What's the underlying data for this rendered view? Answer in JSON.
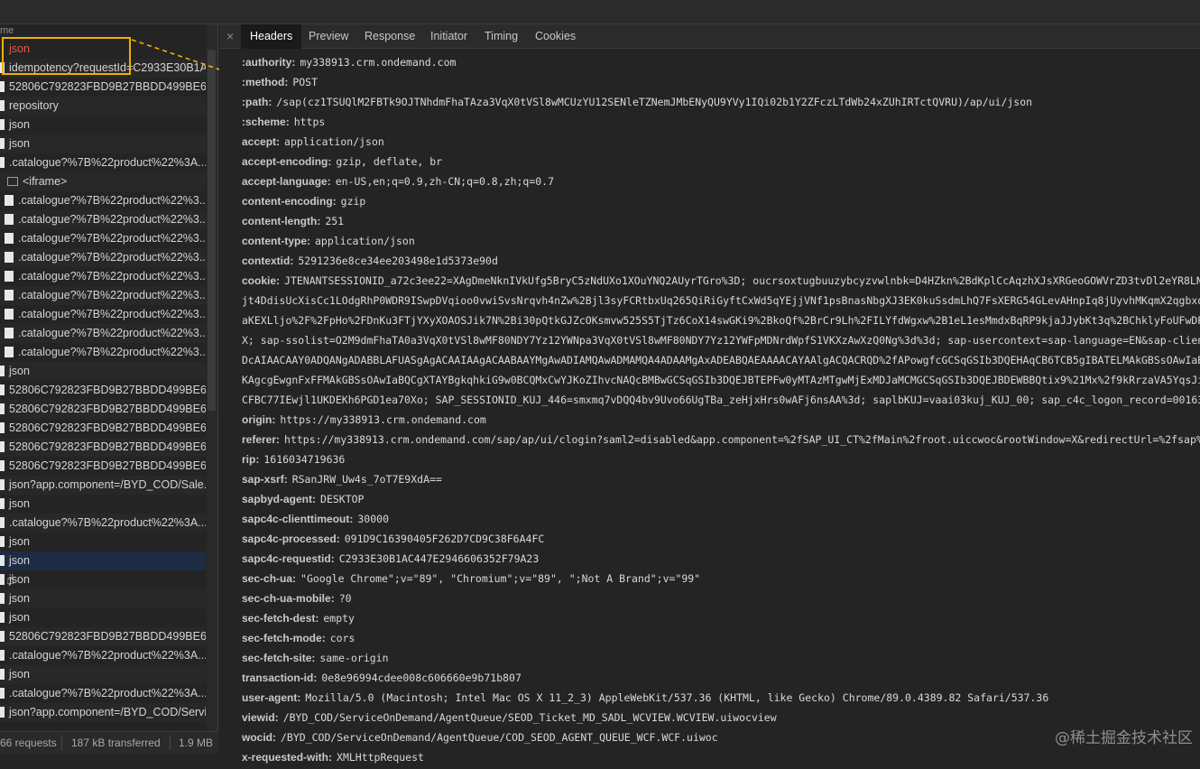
{
  "left_panel": {
    "header_label": "me",
    "items": [
      {
        "label": "json",
        "type": "red"
      },
      {
        "label": "idempotency?requestId=C2933E30B1A...",
        "type": "file"
      },
      {
        "label": "52806C792823FBD9B27BBDD499BE6...",
        "type": "file"
      },
      {
        "label": "repository",
        "type": "file"
      },
      {
        "label": "json",
        "type": "file"
      },
      {
        "label": "json",
        "type": "file"
      },
      {
        "label": ".catalogue?%7B%22product%22%3A...",
        "type": "file"
      },
      {
        "label": "<iframe>",
        "type": "frame"
      },
      {
        "label": ".catalogue?%7B%22product%22%3...",
        "type": "indent"
      },
      {
        "label": ".catalogue?%7B%22product%22%3...",
        "type": "indent"
      },
      {
        "label": ".catalogue?%7B%22product%22%3...",
        "type": "indent"
      },
      {
        "label": ".catalogue?%7B%22product%22%3...",
        "type": "indent"
      },
      {
        "label": ".catalogue?%7B%22product%22%3...",
        "type": "indent"
      },
      {
        "label": ".catalogue?%7B%22product%22%3...",
        "type": "indent"
      },
      {
        "label": ".catalogue?%7B%22product%22%3...",
        "type": "indent"
      },
      {
        "label": ".catalogue?%7B%22product%22%3...",
        "type": "indent"
      },
      {
        "label": ".catalogue?%7B%22product%22%3...",
        "type": "indent"
      },
      {
        "label": "json",
        "type": "file"
      },
      {
        "label": "52806C792823FBD9B27BBDD499BE6...",
        "type": "file"
      },
      {
        "label": "52806C792823FBD9B27BBDD499BE6...",
        "type": "file"
      },
      {
        "label": "52806C792823FBD9B27BBDD499BE6...",
        "type": "file"
      },
      {
        "label": "52806C792823FBD9B27BBDD499BE6...",
        "type": "file"
      },
      {
        "label": "52806C792823FBD9B27BBDD499BE6...",
        "type": "file"
      },
      {
        "label": "json?app.component=/BYD_COD/Sale...",
        "type": "file"
      },
      {
        "label": "json",
        "type": "file"
      },
      {
        "label": ".catalogue?%7B%22product%22%3A...",
        "type": "file"
      },
      {
        "label": "json",
        "type": "file"
      },
      {
        "label": "json",
        "type": "selected"
      },
      {
        "label": "json",
        "type": "file"
      },
      {
        "label": "json",
        "type": "file"
      },
      {
        "label": "json",
        "type": "file"
      },
      {
        "label": "52806C792823FBD9B27BBDD499BE6...",
        "type": "file"
      },
      {
        "label": ".catalogue?%7B%22product%22%3A...",
        "type": "file"
      },
      {
        "label": "json",
        "type": "file"
      },
      {
        "label": ".catalogue?%7B%22product%22%3A...",
        "type": "file"
      },
      {
        "label": "json?app.component=/BYD_COD/Servi...",
        "type": "file"
      }
    ],
    "status": {
      "requests": "66 requests",
      "transferred": "187 kB transferred",
      "resources": "1.9 MB"
    }
  },
  "tabs": [
    {
      "label": "Headers",
      "active": true
    },
    {
      "label": "Preview",
      "active": false
    },
    {
      "label": "Response",
      "active": false
    },
    {
      "label": "Initiator",
      "active": false
    },
    {
      "label": "Timing",
      "active": false
    },
    {
      "label": "Cookies",
      "active": false
    }
  ],
  "headers": [
    {
      "k": ":authority:",
      "v": "my338913.crm.ondemand.com"
    },
    {
      "k": ":method:",
      "v": "POST"
    },
    {
      "k": ":path:",
      "v": "/sap(cz1TSUQlM2FBTk9OJTNhdmFhaTAza3VqX0tVSl8wMCUzYU12SENleTZNemJMbENyQU9YVy1IQi02b1Y2ZFczLTdWb24xZUhIRTctQVRU)/ap/ui/json"
    },
    {
      "k": ":scheme:",
      "v": "https"
    },
    {
      "k": "accept:",
      "v": "application/json"
    },
    {
      "k": "accept-encoding:",
      "v": "gzip, deflate, br"
    },
    {
      "k": "accept-language:",
      "v": "en-US,en;q=0.9,zh-CN;q=0.8,zh;q=0.7"
    },
    {
      "k": "content-encoding:",
      "v": "gzip"
    },
    {
      "k": "content-length:",
      "v": "251"
    },
    {
      "k": "content-type:",
      "v": "application/json"
    },
    {
      "k": "contextid:",
      "v": "5291236e8ce34ee203498e1d5373e90d"
    },
    {
      "k": "cookie:",
      "v": "JTENANTSESSIONID_a72c3ee22=XAgDmeNknIVkUfg5BryC5zNdUXo1XOuYNQ2AUyrTGro%3D; oucrsoxtugbuuzybcyzvwlnbk=D4HZkn%2BdKplCcAqzhXJsXRGeoGOWVrZD3tvDl2eYR8LN0tyPqM"
    },
    {
      "k": "",
      "v": "jt4DdisUcXisCc1LOdgRhP0WDR9ISwpDVqioo0vwiSvsNrqvh4nZw%2Bjl3syFCRtbxUq265QiRiGyftCxWd5qYEjjVNf1psBnasNbgXJ3EK0kuSsdmLhQ7FsXERG54GLevAHnpIq8jUyvhMKqmX2qgbxq7b21W"
    },
    {
      "k": "",
      "v": "aKEXLljo%2F%2FpHo%2FDnKu3FTjYXyXOAOSJik7N%2Bi30pQtkGJZcOKsmvw525S5TjTz6CoX14swGKi9%2BkoQf%2BrCr9Lh%2FILYfdWgxw%2B1eL1esMmdxBqRP9kjaJJybKt3q%2BChklyFoUFwDPKAg69W"
    },
    {
      "k": "",
      "v": "X; sap-ssolist=O2M9dmFhaTA0a3VqX0tVSl8wMF80NDY7Yz12YWNpa3VqX0tVSl8wMF80NDY7Yz12YWFpMDNrdWpfS1VKXzAwXzQ0Ng%3d%3d; sap-usercontext=sap-language=EN&sap-client=446;"
    },
    {
      "k": "",
      "v": "DcAIAACAAY0ADQANgADABBLAFUASgAgACAAIAAgACAABAAYMgAwADIAMQAwADMAMQA4ADAAMgAxADEABQAEAAAACAYAAlgACQACRQD%2fAPowgfcGCSqGSIb3DQEHAqCB6TCB5gIBATELMAkGBSsOAwIaBQAwCwYJ"
    },
    {
      "k": "",
      "v": "KAgcgEwgnFxFFMAkGBSsOAwIaBQCgXTAYBgkqhkiG9w0BCQMxCwYJKoZIhvcNAQcBMBwGCSqGSIb3DQEJBTEPFw0yMTAzMTgwMjExMDJaMCMGCSqGSIb3DQEJBDEWBBQtix9%21Mx%2f9kRrzaVA5YqsJiJ8qtjA"
    },
    {
      "k": "",
      "v": "CFBC77IEwjl1UKDEKh6PGD1ea70Xo; SAP_SESSIONID_KUJ_446=smxmq7vDQQ4bv9Uvo66UgTBa_zeHjxHrs0wAFj6nsAA%3d; saplbKUJ=vaai03kuj_KUJ_00; sap_c4c_logon_record=00163EA7B0A"
    },
    {
      "k": "origin:",
      "v": "https://my338913.crm.ondemand.com"
    },
    {
      "k": "referer:",
      "v": "https://my338913.crm.ondemand.com/sap/ap/ui/clogin?saml2=disabled&app.component=%2fSAP_UI_CT%2fMain%2froot.uiccwoc&rootWindow=X&redirectUrl=%2fsap%2fpubl"
    },
    {
      "k": "rip:",
      "v": "1616034719636"
    },
    {
      "k": "sap-xsrf:",
      "v": "RSanJRW_Uw4s_7oT7E9XdA=="
    },
    {
      "k": "sapbyd-agent:",
      "v": "DESKTOP"
    },
    {
      "k": "sapc4c-clienttimeout:",
      "v": "30000"
    },
    {
      "k": "sapc4c-processed:",
      "v": "091D9C16390405F262D7CD9C38F6A4FC"
    },
    {
      "k": "sapc4c-requestid:",
      "v": "C2933E30B1AC447E2946606352F79A23"
    },
    {
      "k": "sec-ch-ua:",
      "v": "\"Google Chrome\";v=\"89\", \"Chromium\";v=\"89\", \";Not A Brand\";v=\"99\""
    },
    {
      "k": "sec-ch-ua-mobile:",
      "v": "?0"
    },
    {
      "k": "sec-fetch-dest:",
      "v": "empty"
    },
    {
      "k": "sec-fetch-mode:",
      "v": "cors"
    },
    {
      "k": "sec-fetch-site:",
      "v": "same-origin"
    },
    {
      "k": "transaction-id:",
      "v": "0e8e96994cdee008c606660e9b71b807"
    },
    {
      "k": "user-agent:",
      "v": "Mozilla/5.0 (Macintosh; Intel Mac OS X 11_2_3) AppleWebKit/537.36 (KHTML, like Gecko) Chrome/89.0.4389.82 Safari/537.36"
    },
    {
      "k": "viewid:",
      "v": "/BYD_COD/ServiceOnDemand/AgentQueue/SEOD_Ticket_MD_SADL_WCVIEW.WCVIEW.uiwocview"
    },
    {
      "k": "wocid:",
      "v": "/BYD_COD/ServiceOnDemand/AgentQueue/COD_SEOD_AGENT_QUEUE_WCF.WCF.uiwoc"
    },
    {
      "k": "x-requested-with:",
      "v": "XMLHttpRequest"
    }
  ],
  "watermark": "@稀土掘金技术社区",
  "colors": {
    "highlight_box": "#f0b000",
    "error_text": "#e55a4e",
    "selected_row": "#1e2b45"
  }
}
